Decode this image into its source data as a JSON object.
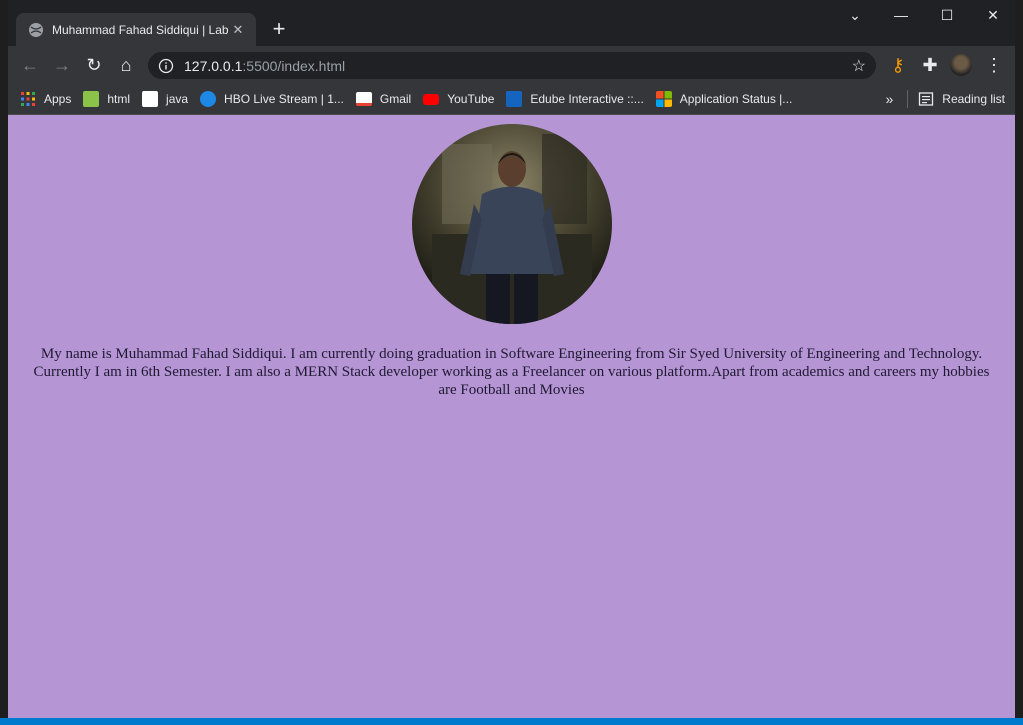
{
  "browser": {
    "tab_title": "Muhammad Fahad Siddiqui | Lab",
    "new_tab_label": "+",
    "address": {
      "host": "127.0.0.1",
      "path": ":5500/index.html"
    },
    "window_controls": {
      "dropdown": "⌄",
      "minimize": "—",
      "maximize": "☐",
      "close": "✕"
    }
  },
  "bookmarks": {
    "items": [
      {
        "label": "Apps",
        "color": "#e53935"
      },
      {
        "label": "html",
        "color": "#8bc34a"
      },
      {
        "label": "java",
        "color": "#ffffff"
      },
      {
        "label": "HBO Live Stream | 1...",
        "color": "#1e88e5"
      },
      {
        "label": "Gmail",
        "color": "#ea4335"
      },
      {
        "label": "YouTube",
        "color": "#ff0000"
      },
      {
        "label": "Edube Interactive ::...",
        "color": "#1565c0"
      },
      {
        "label": "Application Status |...",
        "color": "#f25022"
      }
    ],
    "more": "»",
    "reading_list": "Reading list"
  },
  "page": {
    "background": "#b595d4",
    "bio": "My name is Muhammad Fahad Siddiqui. I am currently doing graduation in Software Engineering from Sir Syed University of Engineering and Technology. Currently I am in 6th Semester. I am also a MERN Stack developer working as a Freelancer on various platform.Apart from academics and careers my hobbies are Football and Movies"
  }
}
